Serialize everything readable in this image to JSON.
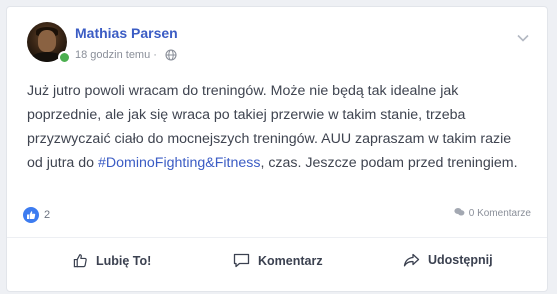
{
  "post": {
    "author": "Mathias Parsen",
    "time_ago": "18 godzin temu",
    "time_separator": "·",
    "text_before_hashtag": "Już jutro powoli wracam do treningów. Może nie będą tak idealne jak poprzednie, ale jak się wraca po takiej przerwie w takim stanie, trzeba przyzwyczaić ciało do mocnejszych treningów. AUU zapraszam w takim razie od jutra do ",
    "hashtag": "#DominoFighting&Fitness",
    "text_after_hashtag": ", czas. Jeszcze podam przed treningiem.",
    "like_count": "2",
    "comments_label": "0 Komentarze"
  },
  "actions": {
    "like_label": "Lubię To!",
    "comment_label": "Komentarz",
    "share_label": "Udostępnij"
  },
  "colors": {
    "accent": "#3b5cc4",
    "like_blue": "#3d7cf0",
    "online_green": "#4caf50"
  },
  "icons": {
    "visibility": "globe-icon",
    "menu": "chevron-down-icon",
    "like": "thumbs-up-icon",
    "comment": "speech-bubble-icon",
    "share": "share-arrow-icon"
  }
}
